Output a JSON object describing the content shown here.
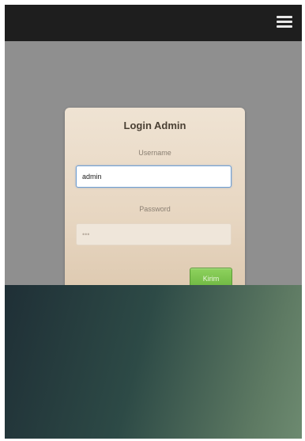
{
  "header": {
    "menu_icon": "hamburger-menu-icon"
  },
  "login_card": {
    "title": "Login Admin",
    "username_label": "Username",
    "username_value": "admin",
    "password_label": "Password",
    "password_value": "•••",
    "submit_label": "Kirim"
  },
  "colors": {
    "topbar": "#1e1e1e",
    "overlay": "#8f8f8f",
    "card": "#e7d6c1",
    "button": "#6cb53f",
    "focus_border": "#6f9fd3"
  }
}
